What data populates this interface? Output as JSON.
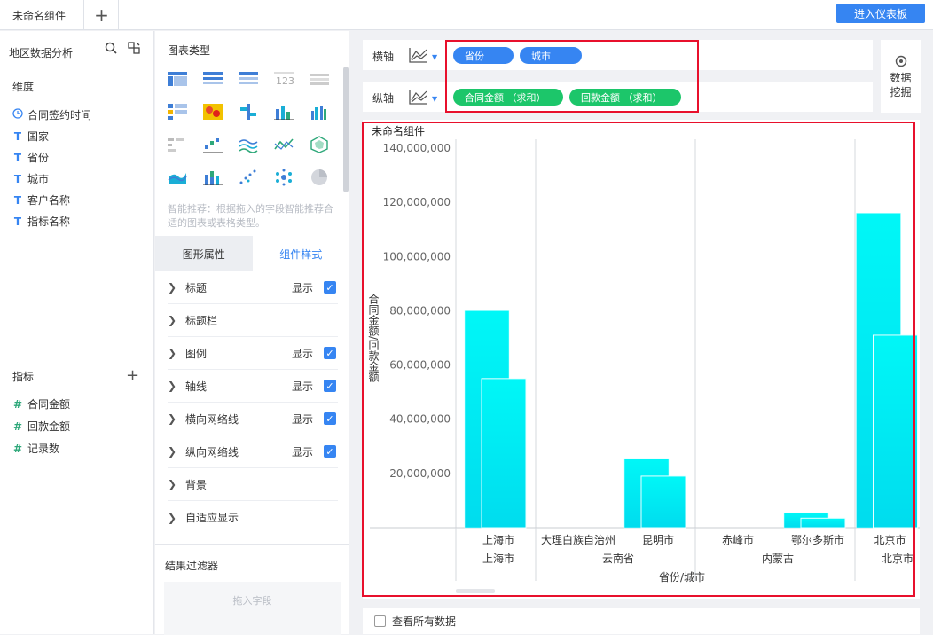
{
  "topbar": {
    "tab_label": "未命名组件",
    "add_tab_label": "+",
    "enter_dashboard": "进入仪表板"
  },
  "dataset": {
    "title": "地区数据分析",
    "dimension_label": "维度",
    "dimensions": [
      {
        "label": "合同签约时间",
        "icon": "clock-icon"
      },
      {
        "label": "国家",
        "icon": "text-field-icon"
      },
      {
        "label": "省份",
        "icon": "text-field-icon"
      },
      {
        "label": "城市",
        "icon": "text-field-icon"
      },
      {
        "label": "客户名称",
        "icon": "text-field-icon"
      },
      {
        "label": "指标名称",
        "icon": "text-field-icon"
      }
    ],
    "metric_label": "指标",
    "metrics": [
      {
        "label": "合同金额",
        "icon": "number-field-icon"
      },
      {
        "label": "回款金额",
        "icon": "number-field-icon"
      },
      {
        "label": "记录数",
        "icon": "number-field-icon"
      }
    ]
  },
  "config": {
    "chart_type_title": "图表类型",
    "hint": "智能推荐：根据拖入的字段智能推荐合适的图表或表格类型。",
    "subtabs": [
      "图形属性",
      "组件样式"
    ],
    "properties": [
      {
        "label": "标题",
        "show": "显示",
        "checked": true
      },
      {
        "label": "标题栏",
        "show": "",
        "checked": false
      },
      {
        "label": "图例",
        "show": "显示",
        "checked": true
      },
      {
        "label": "轴线",
        "show": "显示",
        "checked": true
      },
      {
        "label": "横向网络线",
        "show": "显示",
        "checked": true
      },
      {
        "label": "纵向网络线",
        "show": "显示",
        "checked": true
      },
      {
        "label": "背景",
        "show": "",
        "checked": false
      },
      {
        "label": "自适应显示",
        "show": "",
        "checked": false
      }
    ],
    "filter_title": "结果过滤器",
    "filter_placeholder": "拖入字段"
  },
  "axes": {
    "x_label": "横轴",
    "y_label": "纵轴",
    "x_fields": [
      "省份",
      "城市"
    ],
    "y_fields": [
      "合同金额 （求和）",
      "回款金额 （求和）"
    ]
  },
  "mining": {
    "line1": "数据",
    "line2": "挖掘"
  },
  "bottom": {
    "view_all": "查看所有数据"
  },
  "colors": {
    "accent": "#3685f2",
    "green_pill": "#1cc66a",
    "bar": "#00f5f5",
    "highlight": "#e8102c"
  },
  "chart_data": {
    "type": "bar",
    "title": "未命名组件",
    "xlabel": "省份/城市",
    "ylabel": "合同金额/回款金额",
    "ylim": [
      0,
      140000000
    ],
    "yticks": [
      "20,000,000",
      "40,000,000",
      "60,000,000",
      "80,000,000",
      "100,000,000",
      "120,000,000",
      "140,000,000"
    ],
    "groups": [
      {
        "province": "上海市",
        "cities": [
          {
            "city": "上海市",
            "contract": 80000000,
            "payment": 55000000
          }
        ]
      },
      {
        "province": "云南省",
        "cities": [
          {
            "city": "大理白族自治州",
            "contract": 0,
            "payment": 0
          },
          {
            "city": "昆明市",
            "contract": 25500000,
            "payment": 19000000
          }
        ]
      },
      {
        "province": "内蒙古",
        "cities": [
          {
            "city": "赤峰市",
            "contract": 0,
            "payment": 0
          },
          {
            "city": "鄂尔多斯市",
            "contract": 5500000,
            "payment": 3500000
          }
        ]
      },
      {
        "province": "北京市",
        "cities": [
          {
            "city": "北京市",
            "contract": 116000000,
            "payment": 71000000
          }
        ]
      }
    ],
    "grid": true,
    "legend": "none"
  }
}
